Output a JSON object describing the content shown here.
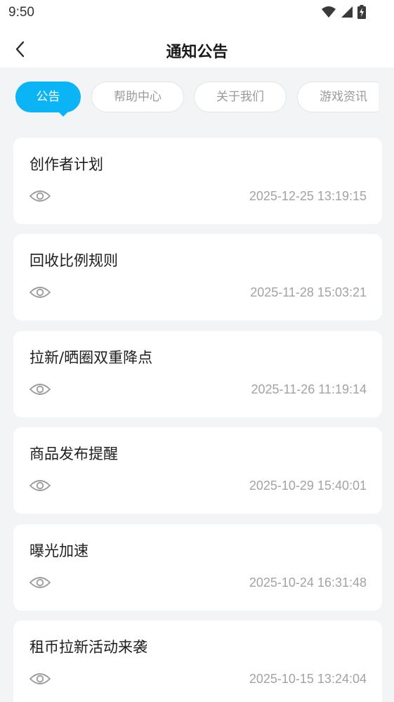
{
  "status_bar": {
    "time": "9:50",
    "icons": [
      "wifi-icon",
      "cellular-signal-icon",
      "battery-charging-icon"
    ]
  },
  "header": {
    "back_icon": "chevron-left-icon",
    "title": "通知公告"
  },
  "tabs": [
    {
      "label": "公告",
      "active": true
    },
    {
      "label": "帮助中心",
      "active": false
    },
    {
      "label": "关于我们",
      "active": false
    },
    {
      "label": "游戏资讯",
      "active": false
    }
  ],
  "colors": {
    "accent": "#0ab4f5",
    "background": "#f3f4f6",
    "card": "#ffffff",
    "muted_text": "#a3a3a3"
  },
  "notices": [
    {
      "title": "创作者计划",
      "date": "2025-12-25 13:19:15",
      "icon": "eye-icon"
    },
    {
      "title": "回收比例规则",
      "date": "2025-11-28 15:03:21",
      "icon": "eye-icon"
    },
    {
      "title": "拉新/晒圈双重降点",
      "date": "2025-11-26 11:19:14",
      "icon": "eye-icon"
    },
    {
      "title": "商品发布提醒",
      "date": "2025-10-29 15:40:01",
      "icon": "eye-icon"
    },
    {
      "title": "曝光加速",
      "date": "2025-10-24 16:31:48",
      "icon": "eye-icon"
    },
    {
      "title": "租币拉新活动来袭",
      "date": "2025-10-15 13:24:04",
      "icon": "eye-icon"
    }
  ]
}
